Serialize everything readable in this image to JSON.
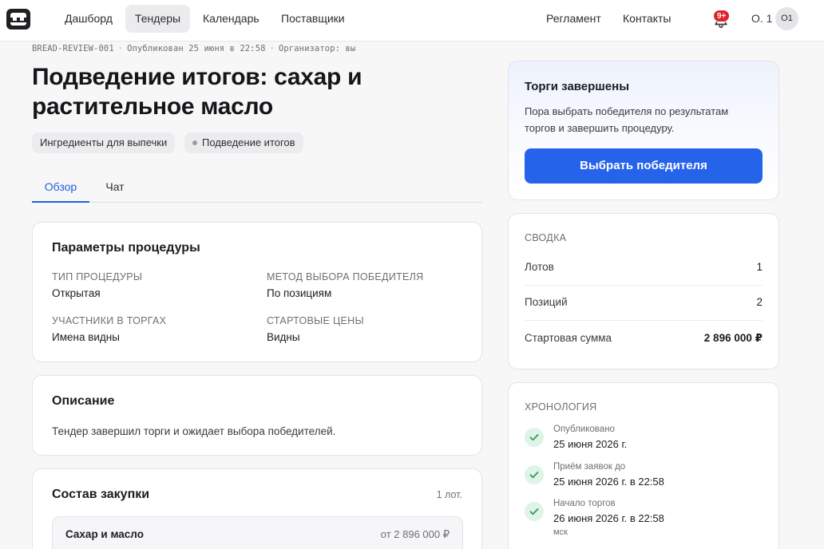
{
  "nav": {
    "items": [
      {
        "label": "Дашборд",
        "active": false
      },
      {
        "label": "Тендеры",
        "active": true
      },
      {
        "label": "Календарь",
        "active": false
      },
      {
        "label": "Поставщики",
        "active": false
      }
    ],
    "right_links": [
      {
        "label": "Регламент"
      },
      {
        "label": "Контакты"
      }
    ],
    "notifications_badge": "9+",
    "user_name": "О. 1",
    "avatar_initials": "О1"
  },
  "tender": {
    "code": "BREAD-REVIEW-001",
    "published": "Опубликован 25 июня в 22:58",
    "organizer": "Организатор: вы",
    "title": "Подведение итогов: сахар и растительное масло",
    "category_chip": "Ингредиенты для выпечки",
    "status_chip": "Подведение итогов"
  },
  "tabs": [
    {
      "label": "Обзор",
      "active": true
    },
    {
      "label": "Чат",
      "active": false
    }
  ],
  "params": {
    "title": "Параметры процедуры",
    "fields": [
      {
        "label": "Тип процедуры",
        "value": "Открытая"
      },
      {
        "label": "Метод выбора победителя",
        "value": "По позициям"
      },
      {
        "label": "Участники в торгах",
        "value": "Имена видны"
      },
      {
        "label": "Стартовые цены",
        "value": "Видны"
      }
    ]
  },
  "description": {
    "title": "Описание",
    "text": "Тендер завершил торги и ожидает выбора победителей."
  },
  "purchase": {
    "title": "Состав закупки",
    "count": "1 лот.",
    "lots": [
      {
        "name": "Сахар и масло",
        "price": "от 2 896 000 ₽"
      }
    ]
  },
  "status_card": {
    "title": "Торги завершены",
    "text": "Пора выбрать победителя по результатам торгов и завершить процедуру.",
    "button": "Выбрать победителя"
  },
  "summary": {
    "title": "Сводка",
    "rows": [
      {
        "label": "Лотов",
        "value": "1"
      },
      {
        "label": "Позиций",
        "value": "2"
      },
      {
        "label": "Стартовая сумма",
        "value": "2 896 000 ₽"
      }
    ]
  },
  "timeline": {
    "title": "Хронология",
    "items": [
      {
        "label": "Опубликовано",
        "date": "25 июня 2026 г.",
        "sub": ""
      },
      {
        "label": "Приём заявок до",
        "date": "25 июня 2026 г. в 22:58",
        "sub": ""
      },
      {
        "label": "Начало торгов",
        "date": "26 июня 2026 г. в 22:58",
        "sub": "мск"
      }
    ]
  },
  "colors": {
    "accent": "#2563eb",
    "badge": "#e0232f",
    "success": "#2f9e55"
  },
  "icons": {
    "logo": "robot-face-logo",
    "notifications": "bell-icon",
    "timeline_check": "check-icon"
  }
}
